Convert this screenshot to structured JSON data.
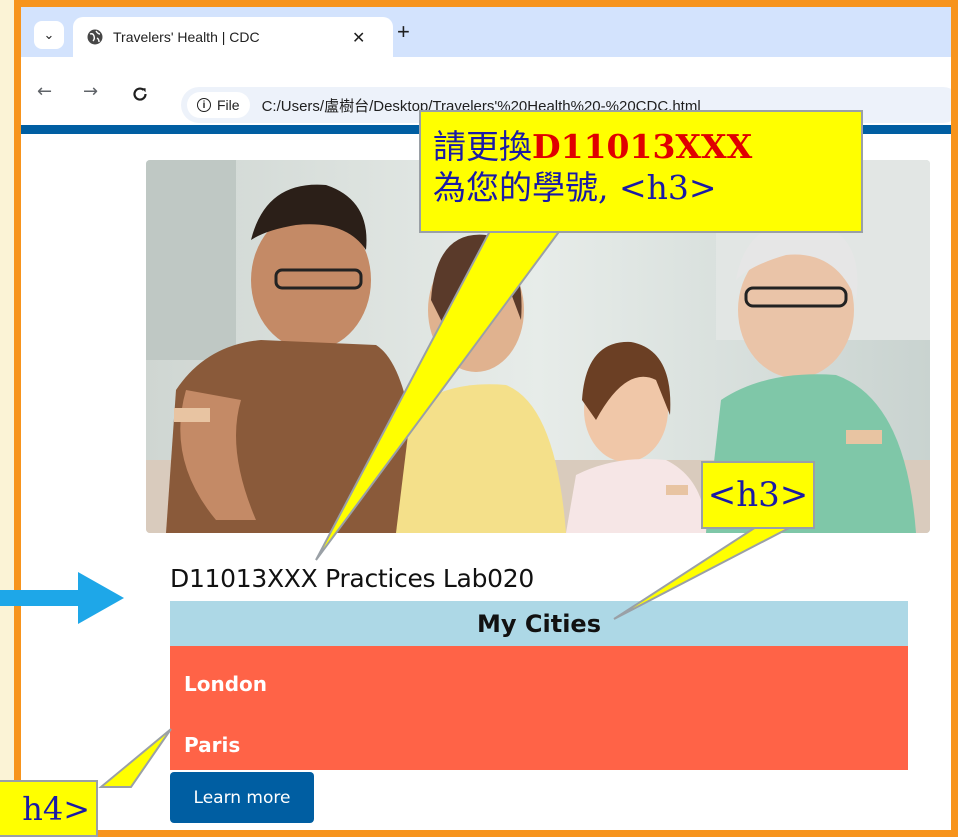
{
  "browser": {
    "tab_title": "Travelers' Health | CDC",
    "chip_label": "File",
    "url": "C:/Users/盧樹台/Desktop/Travelers'%20Health%20-%20CDC.html"
  },
  "page": {
    "heading": "D11013XXX Practices Lab020",
    "cities_title": "My Cities",
    "cities": [
      "London",
      "Paris"
    ],
    "button_label": "Learn more"
  },
  "annotations": {
    "callout_main_prefix": "請更換",
    "callout_main_id": "D11013XXX",
    "callout_main_line2": "為您的學號, <h3>",
    "callout_h3": "<h3>",
    "callout_h4": "h4>"
  },
  "colors": {
    "frame": "#f7941d",
    "cities_header_bg": "#add8e6",
    "cities_list_bg": "#ff6347",
    "button_bg": "#005ea2",
    "callout_bg": "#ffff00",
    "arrow": "#1ea7e8"
  }
}
